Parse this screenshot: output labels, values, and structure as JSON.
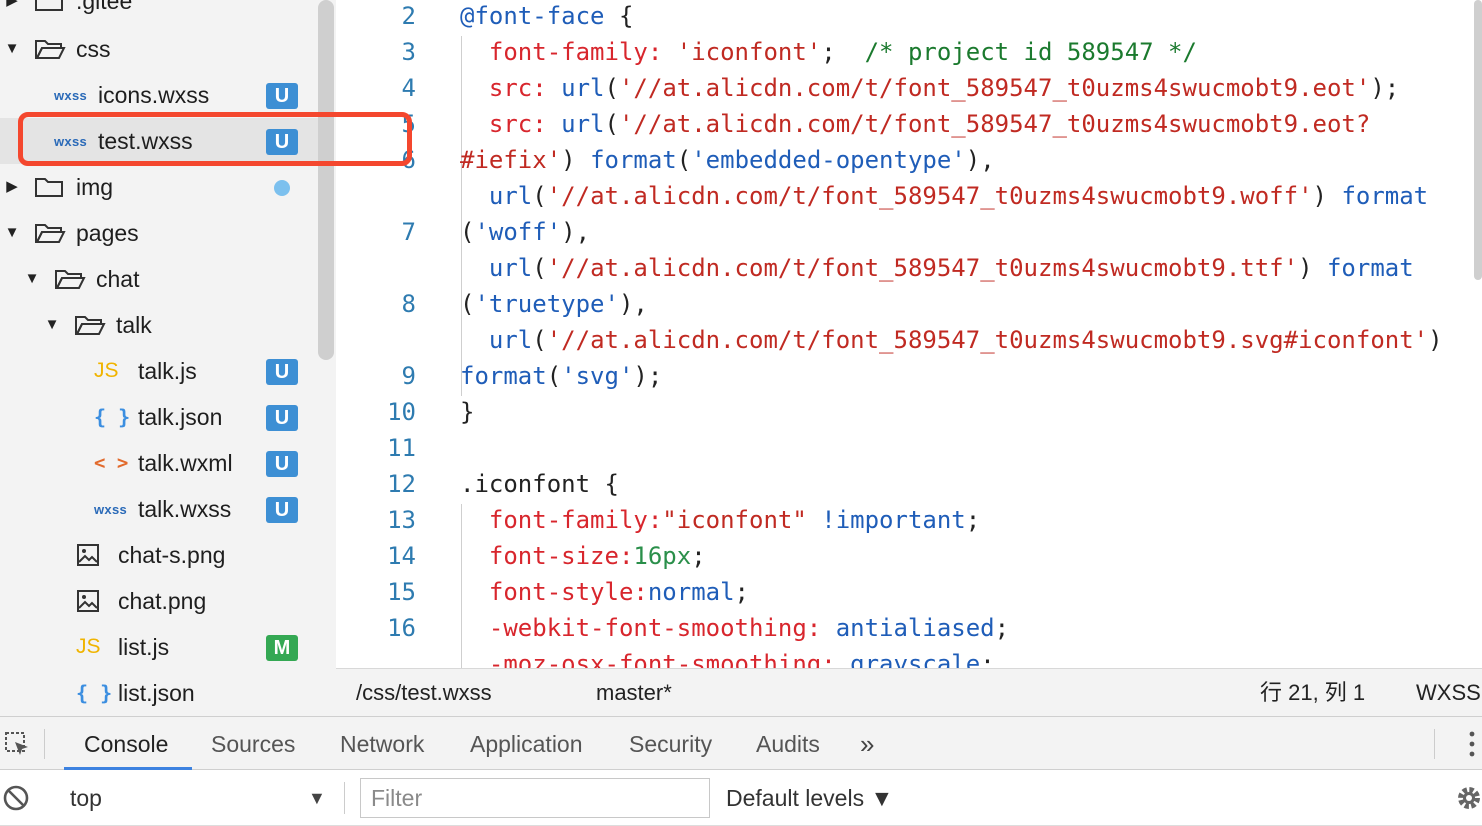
{
  "file_tree": {
    "items": [
      {
        "name": ".gitee",
        "type": "folder",
        "expanded": false
      },
      {
        "name": "css",
        "type": "folder",
        "expanded": true
      },
      {
        "name": "icons.wxss",
        "type": "wxss",
        "badge": "U"
      },
      {
        "name": "test.wxss",
        "type": "wxss",
        "badge": "U",
        "selected": true
      },
      {
        "name": "img",
        "type": "folder",
        "expanded": false
      },
      {
        "name": "pages",
        "type": "folder",
        "expanded": true
      },
      {
        "name": "chat",
        "type": "folder",
        "expanded": true
      },
      {
        "name": "talk",
        "type": "folder",
        "expanded": true
      },
      {
        "name": "talk.js",
        "type": "js",
        "badge": "U"
      },
      {
        "name": "talk.json",
        "type": "json",
        "badge": "U"
      },
      {
        "name": "talk.wxml",
        "type": "wxml",
        "badge": "U"
      },
      {
        "name": "talk.wxss",
        "type": "wxss",
        "badge": "U"
      },
      {
        "name": "chat-s.png",
        "type": "image"
      },
      {
        "name": "chat.png",
        "type": "image"
      },
      {
        "name": "list.js",
        "type": "js",
        "badge": "M"
      },
      {
        "name": "list.json",
        "type": "json"
      }
    ],
    "file_type_labels": {
      "wxss": "wxss",
      "js": "JS",
      "json": "{ }",
      "wxml": "< >"
    },
    "badge_colors": {
      "U": "#3d8fd4",
      "M": "#34a853"
    },
    "highlight_color": "#f4472e"
  },
  "editor": {
    "line_numbers": [
      "2",
      "3",
      "4",
      "5",
      "6",
      "",
      "7",
      "",
      "8",
      "",
      "9",
      "10",
      "11",
      "12",
      "13",
      "14",
      "15",
      "16"
    ],
    "code_lines": [
      [
        [
          "at",
          "@font-face"
        ],
        [
          "pl",
          " {"
        ]
      ],
      [
        [
          "prop",
          "  font-family: "
        ],
        [
          "strr",
          "'iconfont'"
        ],
        [
          "pl",
          ";  "
        ],
        [
          "cm",
          "/* project id 589547 */"
        ]
      ],
      [
        [
          "prop",
          "  src: "
        ],
        [
          "fn",
          "url"
        ],
        [
          "pl",
          "("
        ],
        [
          "strr",
          "'//at.alicdn.com/t/font_589547_t0uzms4swucmobt9.eot'"
        ],
        [
          "pl",
          ");"
        ]
      ],
      [
        [
          "prop",
          "  src: "
        ],
        [
          "fn",
          "url"
        ],
        [
          "pl",
          "("
        ],
        [
          "strr",
          "'//at.alicdn.com/t/font_589547_t0uzms4swucmobt9.eot?"
        ]
      ],
      [
        [
          "strr",
          "#iefix'"
        ],
        [
          "pl",
          ") "
        ],
        [
          "fn",
          "format"
        ],
        [
          "pl",
          "("
        ],
        [
          "str",
          "'embedded-opentype'"
        ],
        [
          "pl",
          "),"
        ]
      ],
      [
        [
          "pl",
          "  "
        ],
        [
          "fn",
          "url"
        ],
        [
          "pl",
          "("
        ],
        [
          "strr",
          "'//at.alicdn.com/t/font_589547_t0uzms4swucmobt9.woff'"
        ],
        [
          "pl",
          ") "
        ],
        [
          "fn",
          "format"
        ]
      ],
      [
        [
          "pl",
          "("
        ],
        [
          "str",
          "'woff'"
        ],
        [
          "pl",
          "),"
        ]
      ],
      [
        [
          "pl",
          "  "
        ],
        [
          "fn",
          "url"
        ],
        [
          "pl",
          "("
        ],
        [
          "strr",
          "'//at.alicdn.com/t/font_589547_t0uzms4swucmobt9.ttf'"
        ],
        [
          "pl",
          ") "
        ],
        [
          "fn",
          "format"
        ]
      ],
      [
        [
          "pl",
          "("
        ],
        [
          "str",
          "'truetype'"
        ],
        [
          "pl",
          "),"
        ]
      ],
      [
        [
          "pl",
          "  "
        ],
        [
          "fn",
          "url"
        ],
        [
          "pl",
          "("
        ],
        [
          "strr",
          "'//at.alicdn.com/t/font_589547_t0uzms4swucmobt9.svg#iconfont'"
        ],
        [
          "pl",
          ")"
        ]
      ],
      [
        [
          "fn",
          "format"
        ],
        [
          "pl",
          "("
        ],
        [
          "str",
          "'svg'"
        ],
        [
          "pl",
          ");"
        ]
      ],
      [
        [
          "pl",
          "}"
        ]
      ],
      [
        [
          "pl",
          ""
        ]
      ],
      [
        [
          "pl",
          ".iconfont {"
        ]
      ],
      [
        [
          "prop",
          "  font-family:"
        ],
        [
          "strr",
          "\"iconfont\""
        ],
        [
          "pl",
          " "
        ],
        [
          "kw",
          "!important"
        ],
        [
          "pl",
          ";"
        ]
      ],
      [
        [
          "prop",
          "  font-size:"
        ],
        [
          "num",
          "16px"
        ],
        [
          "pl",
          ";"
        ]
      ],
      [
        [
          "prop",
          "  font-style:"
        ],
        [
          "kw",
          "normal"
        ],
        [
          "pl",
          ";"
        ]
      ],
      [
        [
          "prop",
          "  -webkit-font-smoothing: "
        ],
        [
          "kw",
          "antialiased"
        ],
        [
          "pl",
          ";"
        ]
      ],
      [
        [
          "prop",
          "  -moz-osx-font-smoothing: "
        ],
        [
          "kw",
          "grayscale"
        ],
        [
          "pl",
          ";"
        ]
      ]
    ]
  },
  "status_bar": {
    "path": "/css/test.wxss",
    "branch": "master*",
    "cursor": "行 21, 列 1",
    "language": "WXSS"
  },
  "devtools": {
    "tabs": [
      "Console",
      "Sources",
      "Network",
      "Application",
      "Security",
      "Audits"
    ],
    "active_tab": "Console",
    "more_tabs": "»",
    "context": "top",
    "filter_placeholder": "Filter",
    "levels": "Default levels ▼"
  }
}
